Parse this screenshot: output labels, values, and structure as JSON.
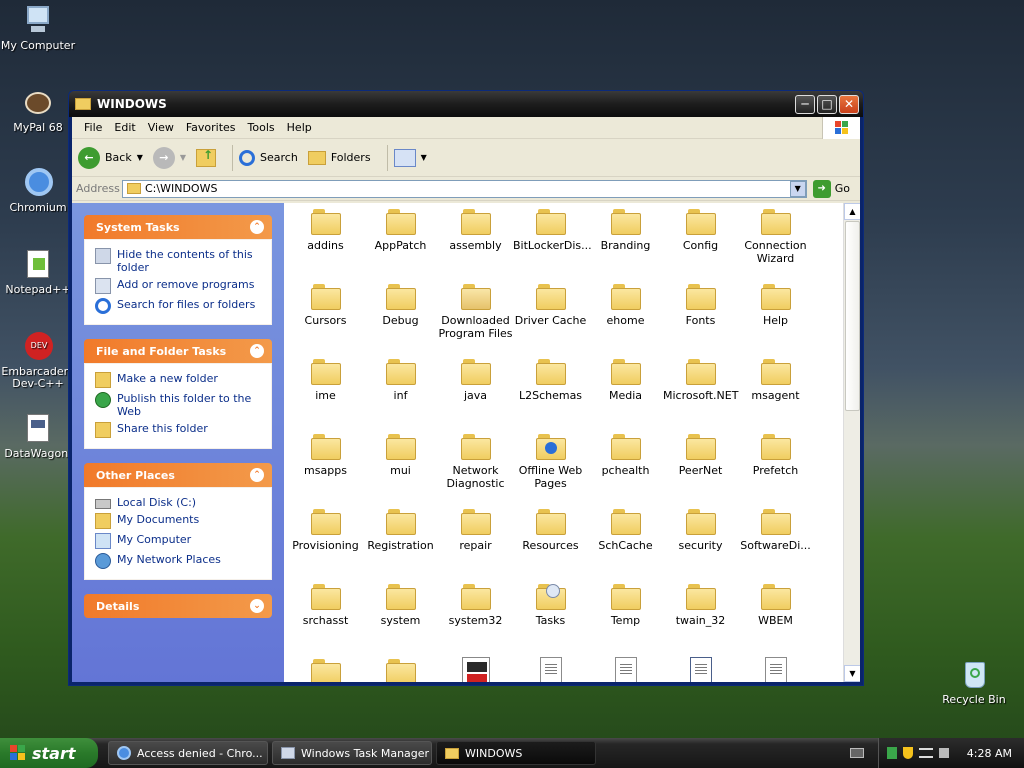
{
  "desktop": {
    "icons": [
      {
        "label": "My Computer"
      },
      {
        "label": "MyPal 68"
      },
      {
        "label": "Chromium"
      },
      {
        "label": "Notepad++"
      },
      {
        "label": "Embarcadero Dev-C++"
      },
      {
        "label": "DataWagon."
      },
      {
        "label": "Recycle Bin"
      }
    ]
  },
  "window": {
    "title": "WINDOWS",
    "menu": [
      "File",
      "Edit",
      "View",
      "Favorites",
      "Tools",
      "Help"
    ],
    "toolbar": {
      "back": "Back",
      "search": "Search",
      "folders": "Folders"
    },
    "address": {
      "label": "Address",
      "value": "C:\\WINDOWS",
      "go": "Go"
    }
  },
  "taskpane": {
    "system_tasks": {
      "title": "System Tasks",
      "items": [
        "Hide the contents of this folder",
        "Add or remove programs",
        "Search for files or folders"
      ]
    },
    "file_folder_tasks": {
      "title": "File and Folder Tasks",
      "items": [
        "Make a new folder",
        "Publish this folder to the Web",
        "Share this folder"
      ]
    },
    "other_places": {
      "title": "Other Places",
      "items": [
        "Local Disk (C:)",
        "My Documents",
        "My Computer",
        "My Network Places"
      ]
    },
    "details": {
      "title": "Details"
    }
  },
  "files": [
    "addins",
    "AppPatch",
    "assembly",
    "BitLockerDis...",
    "Branding",
    "Config",
    "Connection Wizard",
    "Cursors",
    "Debug",
    "Downloaded Program Files",
    "Driver Cache",
    "ehome",
    "Fonts",
    "Help",
    "ime",
    "inf",
    "java",
    "L2Schemas",
    "Media",
    "Microsoft.NET",
    "msagent",
    "msapps",
    "mui",
    "Network Diagnostic",
    "Offline Web Pages",
    "pchealth",
    "PeerNet",
    "Prefetch",
    "Provisioning",
    "Registration",
    "repair",
    "Resources",
    "SchCache",
    "security",
    "SoftwareDi...",
    "srchasst",
    "system",
    "system32",
    "Tasks",
    "Temp",
    "twain_32",
    "WBEM"
  ],
  "taskbar": {
    "start": "start",
    "tasks": [
      "Access denied - Chro...",
      "Windows Task Manager",
      "WINDOWS"
    ],
    "clock": "4:28 AM"
  }
}
